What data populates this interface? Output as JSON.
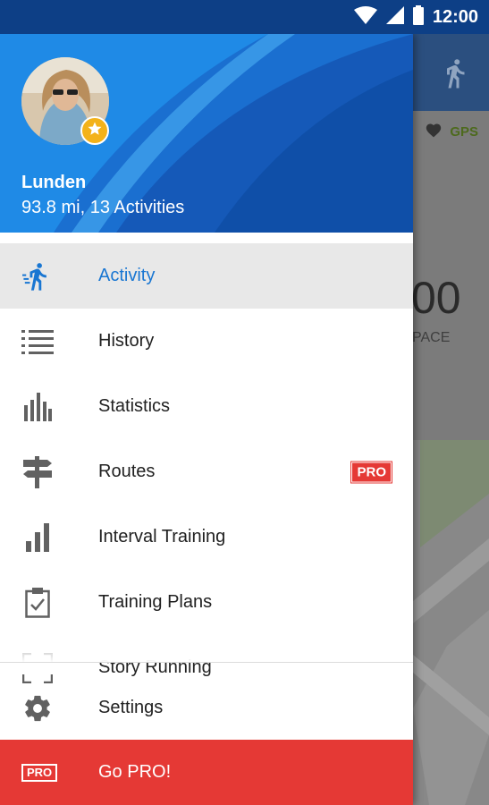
{
  "status_bar": {
    "time": "12:00",
    "icons": [
      "wifi-icon",
      "signal-icon",
      "battery-icon"
    ]
  },
  "background_app": {
    "gps_label": "GPS",
    "big_value": "00",
    "pace_label": "PACE"
  },
  "drawer": {
    "header": {
      "user_name": "Lunden",
      "user_stats": "93.8 mi, 13 Activities"
    },
    "items": [
      {
        "label": "Activity",
        "icon": "runner-icon",
        "active": true
      },
      {
        "label": "History",
        "icon": "list-icon"
      },
      {
        "label": "Statistics",
        "icon": "bar-chart-icon"
      },
      {
        "label": "Routes",
        "icon": "signpost-icon",
        "badge": "PRO"
      },
      {
        "label": "Interval Training",
        "icon": "interval-bars-icon"
      },
      {
        "label": "Training Plans",
        "icon": "clipboard-check-icon"
      },
      {
        "label": "Story Running",
        "icon": "scan-icon"
      }
    ],
    "settings": {
      "label": "Settings",
      "icon": "gear-icon"
    },
    "go_pro": {
      "label": "Go PRO!",
      "badge": "PRO"
    }
  },
  "colors": {
    "accent": "#1976d2",
    "header": "#1769c9",
    "go_pro": "#e53935",
    "star": "#f3b21a"
  }
}
